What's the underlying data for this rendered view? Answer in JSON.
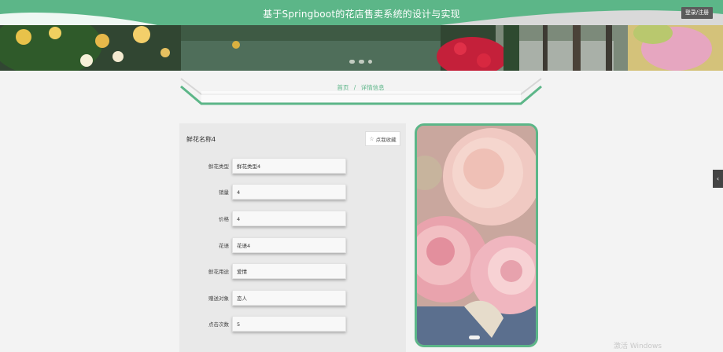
{
  "header": {
    "title": "基于Springboot的花店售卖系统的设计与实现",
    "login_label": "登录/注册"
  },
  "banner": {
    "dots": 3
  },
  "breadcrumb": {
    "home": "首页",
    "separator": "/",
    "current": "详情信息"
  },
  "detail": {
    "name": "鲜花名称4",
    "collect_label": "点我收藏",
    "fields": [
      {
        "label": "鲜花类型",
        "value": "鲜花类型4"
      },
      {
        "label": "销量",
        "value": "4"
      },
      {
        "label": "价格",
        "value": "4"
      },
      {
        "label": "花语",
        "value": "花语4"
      },
      {
        "label": "鲜花用途",
        "value": "爱情"
      },
      {
        "label": "赠送对象",
        "value": "恋人"
      },
      {
        "label": "点击次数",
        "value": "5"
      }
    ]
  },
  "side_tab": {
    "glyph": "‹"
  },
  "watermark": "激活 Windows",
  "colors": {
    "accent": "#5cb688",
    "login_bg": "#5b5b5b"
  }
}
